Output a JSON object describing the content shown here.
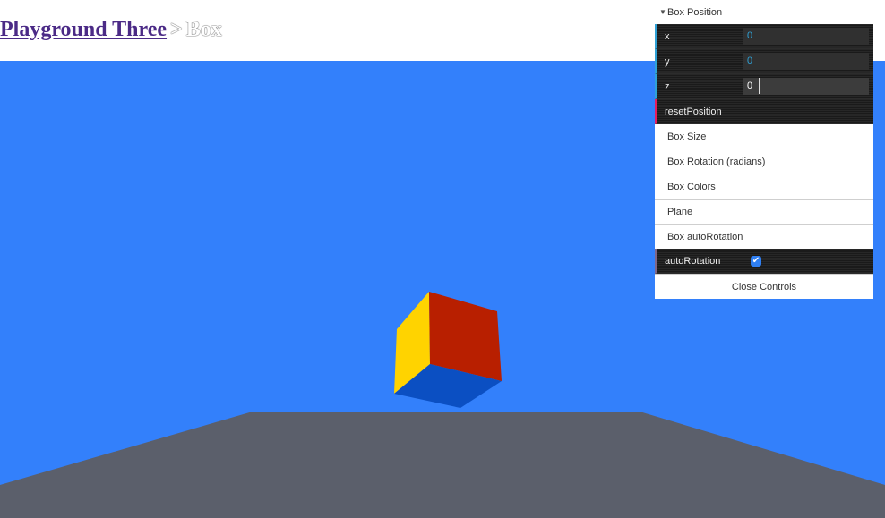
{
  "breadcrumb": {
    "link": "Playground Three",
    "separator": ">",
    "current": "Box"
  },
  "gui": {
    "position_folder": {
      "title": "Box Position",
      "open": true
    },
    "position_fields": [
      {
        "label": "x",
        "value": "0"
      },
      {
        "label": "y",
        "value": "0"
      },
      {
        "label": "z",
        "value": "0"
      }
    ],
    "reset_label": "resetPosition",
    "folders": [
      "Box Size",
      "Box Rotation (radians)",
      "Box Colors",
      "Plane",
      "Box autoRotation"
    ],
    "auto_rotation": {
      "label": "autoRotation",
      "checked": true
    },
    "close_label": "Close Controls"
  },
  "colors": {
    "background": "#3380fb",
    "plane": "#5b5f6b",
    "cube_top": "#b81f00",
    "cube_left": "#ffd300",
    "cube_bottom": "#0b4fc2"
  },
  "icons": {
    "folder_open": "triangle-down-icon",
    "checkbox": "check-icon",
    "text_cursor": "ibeam-cursor-icon"
  }
}
